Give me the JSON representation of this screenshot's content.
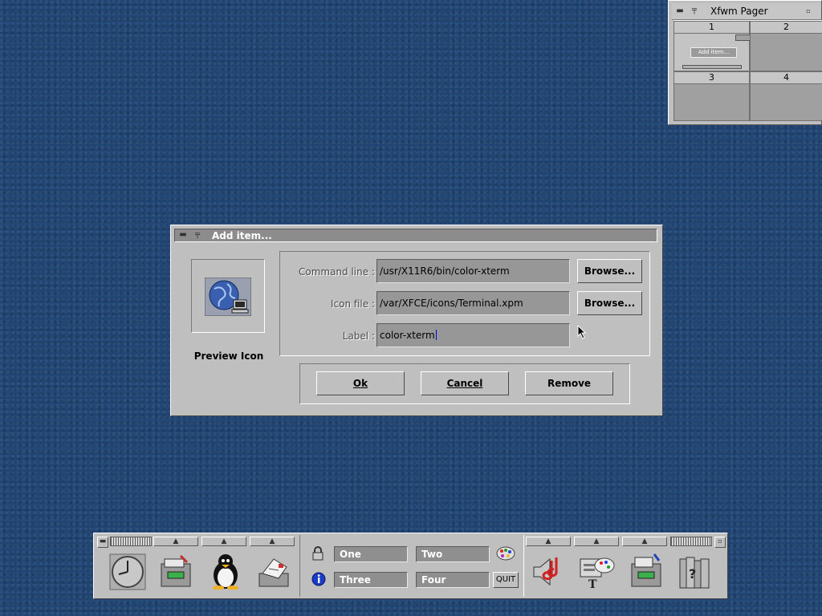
{
  "pager": {
    "title": "Xfwm Pager",
    "desks": [
      "1",
      "2",
      "3",
      "4"
    ],
    "mini_window_label": "Add item..."
  },
  "dialog": {
    "title": "Add item...",
    "preview_label": "Preview Icon",
    "command_line": {
      "label": "Command line :",
      "value": "/usr/X11R6/bin/color-xterm"
    },
    "icon_file": {
      "label": "Icon file :",
      "value": "/var/XFCE/icons/Terminal.xpm"
    },
    "label_field": {
      "label": "Label :",
      "value": "color-xterm"
    },
    "browse_label": "Browse...",
    "buttons": {
      "ok": "Ok",
      "cancel": "Cancel",
      "remove": "Remove"
    }
  },
  "panel": {
    "desktops": [
      "One",
      "Two",
      "Three",
      "Four"
    ],
    "quit_label": "QUIT",
    "left_icons": [
      "clock-icon",
      "file-manager-icon",
      "tux-penguin-icon",
      "mail-icon"
    ],
    "right_icons": [
      "sound-icon",
      "settings-palette-icon",
      "print-manager-icon",
      "help-books-icon"
    ]
  },
  "colors": {
    "desktop_bg": "#1f4472",
    "window_bg": "#bfbfbf",
    "field_bg": "#979797",
    "caret": "#0000ff"
  }
}
